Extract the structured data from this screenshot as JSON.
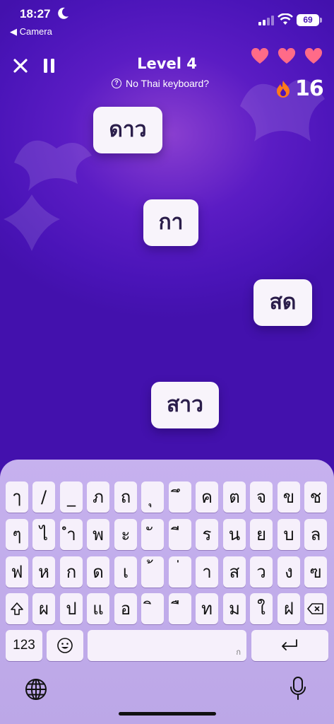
{
  "status_bar": {
    "time": "18:27",
    "back_label": "◀ Camera",
    "battery": "69"
  },
  "header": {
    "level": "Level 4",
    "no_keyboard_label": "No Thai keyboard?",
    "lives": 3,
    "streak": "16",
    "colors": {
      "heart": "#ff6b88",
      "flame": "#ff7a1a"
    }
  },
  "words": [
    "ดาว",
    "กา",
    "สด",
    "สาว"
  ],
  "keyboard": {
    "rows": [
      [
        "ๅ",
        "/",
        "_",
        "ภ",
        "ถ",
        "ุ",
        "ึ",
        "ค",
        "ต",
        "จ",
        "ข",
        "ช"
      ],
      [
        "ๆ",
        "ไ",
        "ำ",
        "พ",
        "ะ",
        "ั",
        "ี",
        "ร",
        "น",
        "ย",
        "บ",
        "ล"
      ],
      [
        "ฟ",
        "ห",
        "ก",
        "ด",
        "เ",
        "้",
        "่",
        "า",
        "ส",
        "ว",
        "ง",
        "ฃ"
      ],
      [
        "ผ",
        "ป",
        "แ",
        "อ",
        "ิ",
        "ื",
        "ท",
        "ม",
        "ใ",
        "ฝ"
      ]
    ],
    "shift_icon": "shift-icon",
    "backspace_icon": "backspace-icon",
    "numbers_label": "123",
    "space_hint": "ก",
    "emoji_icon": "emoji-icon",
    "return_icon": "return-icon",
    "globe_icon": "globe-icon",
    "mic_icon": "microphone-icon"
  }
}
